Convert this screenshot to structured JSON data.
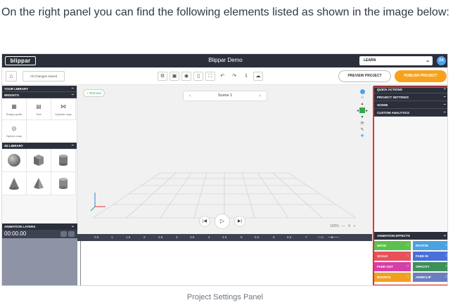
{
  "intro_text": "On the right panel you can find the following elements listed as shown in the image below:",
  "caption": "Project Settings Panel",
  "app": {
    "logo_text": "blippar",
    "title": "Blippar Demo",
    "learn_label": "LEARN",
    "avatar_initials": "ZA"
  },
  "toolbar": {
    "saved_label": "All Changes Saved",
    "preview_label": "PREVIEW PROJECT",
    "publish_label": "PUBLISH PROJECT"
  },
  "left_panel": {
    "your_library": "YOUR LIBRARY",
    "widgets_title": "WIDGETS",
    "widgets": [
      {
        "label": "Empty sprite",
        "icon": "sprite-icon"
      },
      {
        "label": "Text",
        "icon": "text-icon"
      },
      {
        "label": "Cylinder map",
        "icon": "cylinder-map-icon"
      },
      {
        "label": "Sphere map",
        "icon": "sphere-map-icon"
      }
    ],
    "library_3d_title": "3D LIBRARY",
    "animation_layers_title": "ANIMATION LAYERS",
    "time_display": "00:00.00"
  },
  "canvas": {
    "text_tool_label": "Text tool",
    "scene_label": "Scene 1",
    "zoom_label": "100%"
  },
  "timeline": {
    "ticks": [
      "0.5",
      "1",
      "1.5",
      "2",
      "2.5",
      "3",
      "3.5",
      "4",
      "4.5",
      "5",
      "5.5",
      "6",
      "6.5",
      "7"
    ],
    "zoom_label": "0.5s"
  },
  "right_panel": {
    "sections": [
      "QUICK ACTIONS",
      "PROJECT SETTINGS",
      "SCENE",
      "CUSTOM ANALYTICS"
    ],
    "animation_effects_title": "ANIMATION EFFECTS",
    "effects": [
      {
        "label": "MOVE",
        "color": "#5cc04c"
      },
      {
        "label": "ROTATE",
        "color": "#4aa3e0"
      },
      {
        "label": "SCALE",
        "color": "#e8505a"
      },
      {
        "label": "FADE IN",
        "color": "#4a6fd8"
      },
      {
        "label": "FADE OUT",
        "color": "#d63fa8"
      },
      {
        "label": "OPACITY",
        "color": "#3f8f5a"
      },
      {
        "label": "BOUNCE",
        "color": "#f0a020"
      },
      {
        "label": "ANIMCLIP",
        "color": "#6b7fc0"
      }
    ],
    "highlight_color": "#e2342b"
  }
}
